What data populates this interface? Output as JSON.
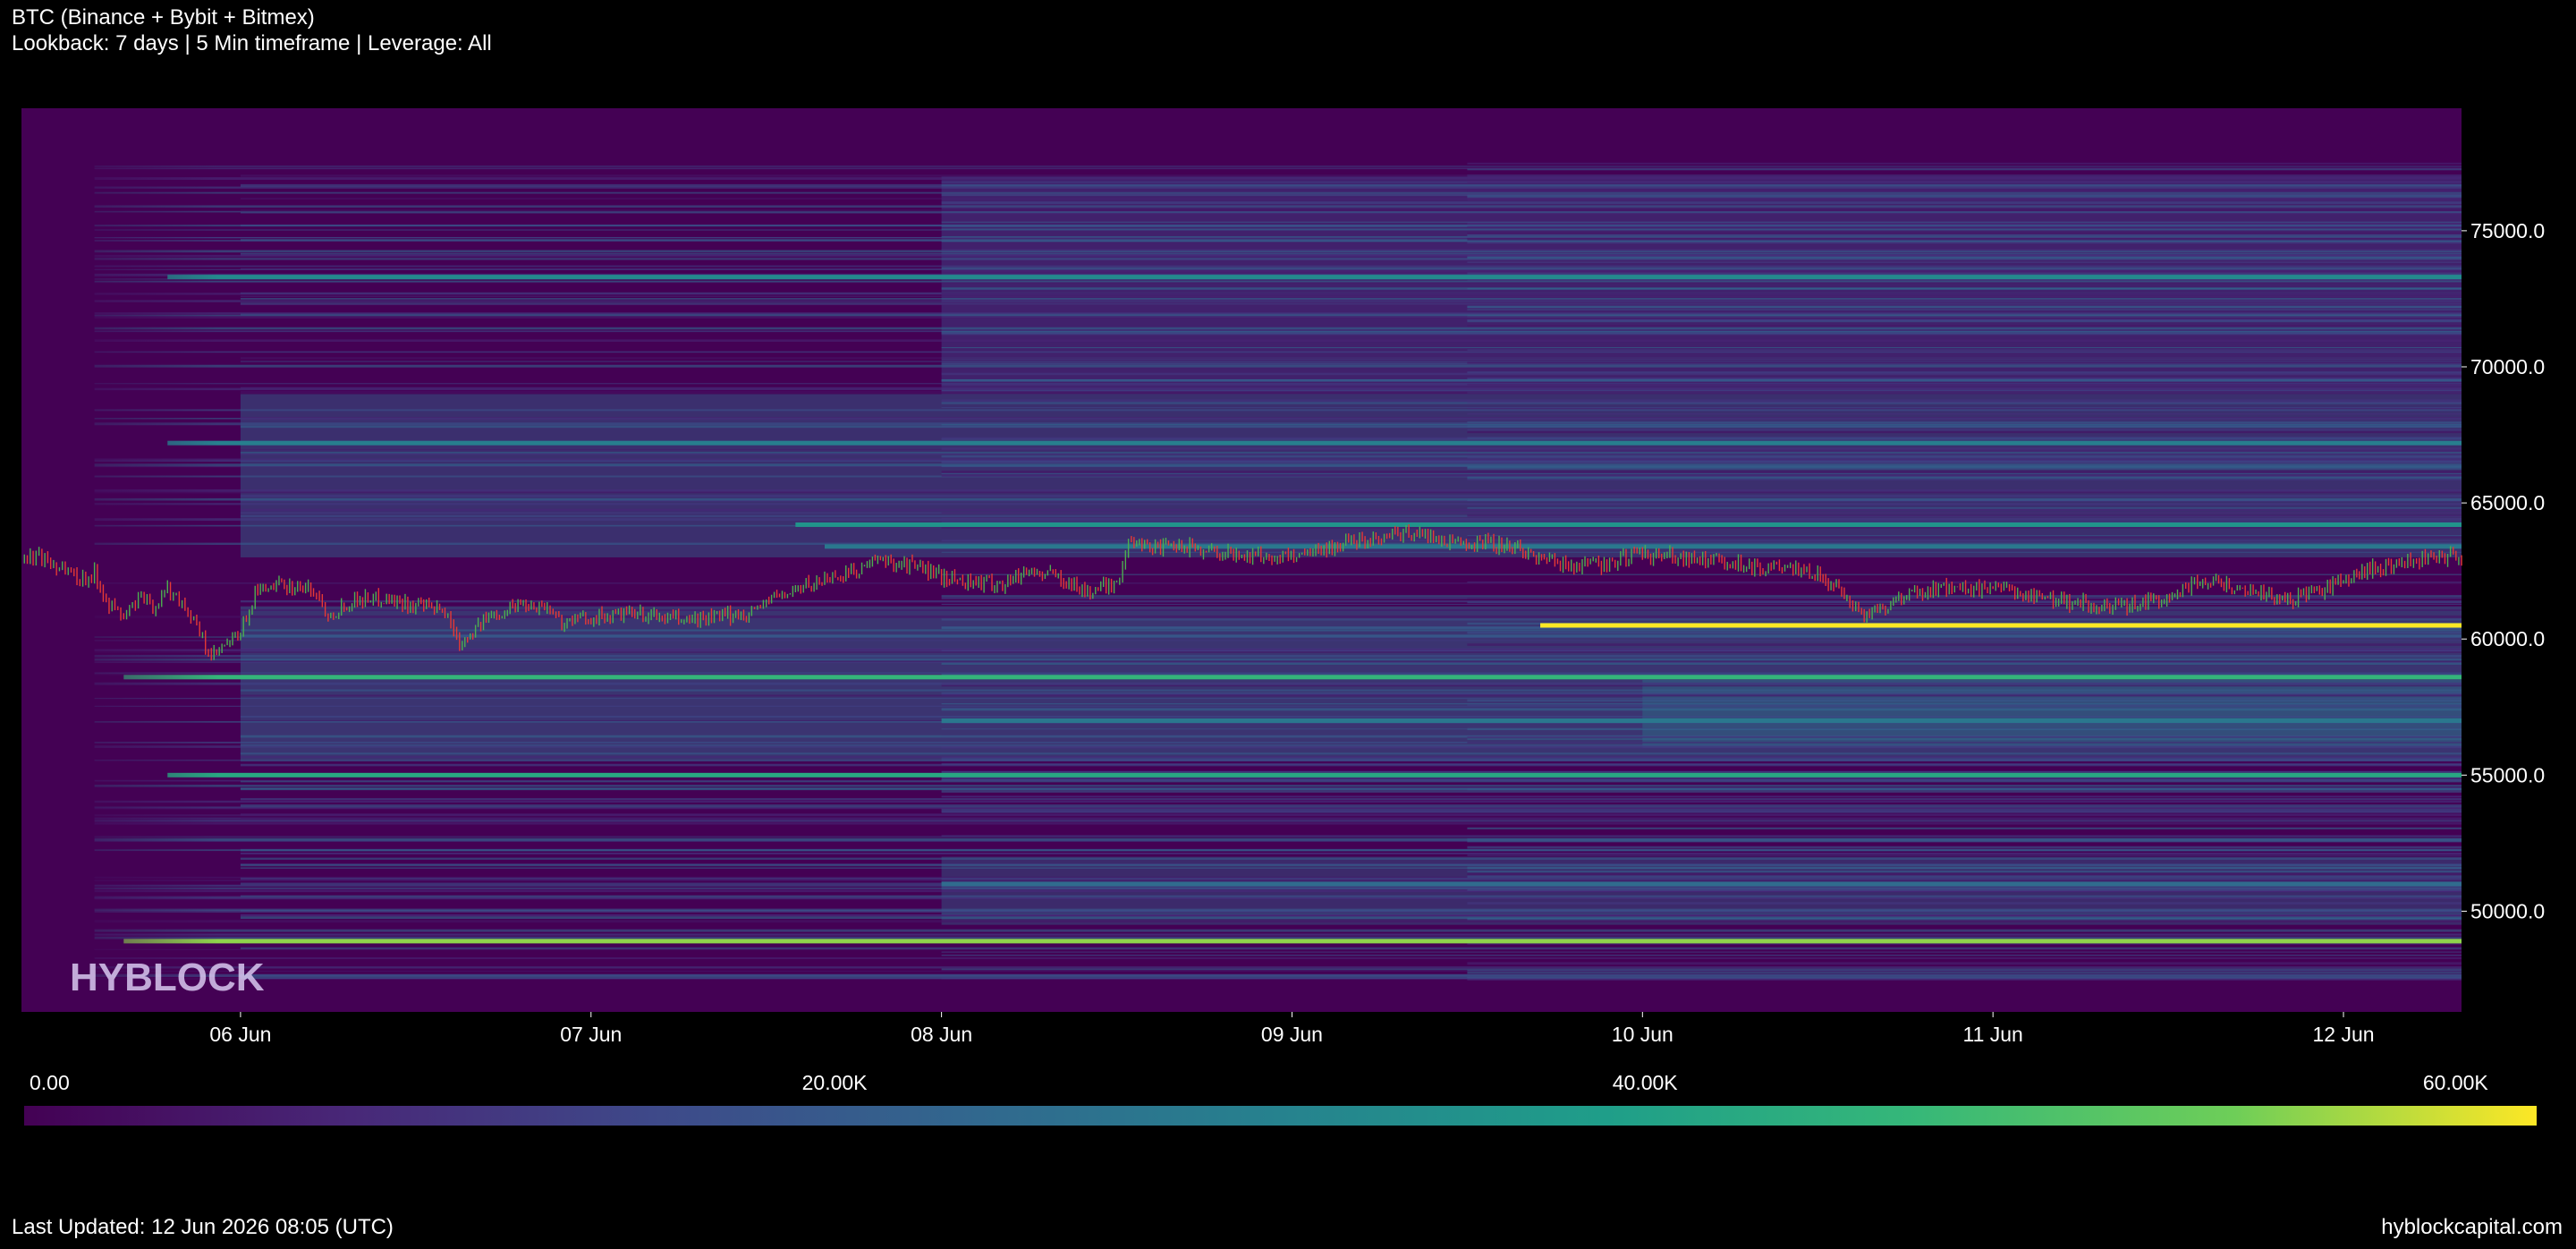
{
  "header": {
    "title": "BTC (Binance + Bybit + Bitmex)",
    "subtitle": "Lookback: 7 days | 5 Min timeframe | Leverage: All"
  },
  "watermark": "HYBLOCK",
  "footer": {
    "last_updated": "Last Updated: 12 Jun 2026 08:05 (UTC)",
    "site": "hyblockcapital.com"
  },
  "colors": {
    "background": "#000000",
    "heatmap_low": "#440154",
    "heatmap_mid": "#21908d",
    "heatmap_high": "#fde725",
    "candle_up": "#4caf50",
    "candle_down": "#e53935"
  },
  "chart_data": {
    "type": "heatmap",
    "x_axis": {
      "type": "date",
      "range": [
        "2026-06-05 09:00",
        "2026-06-12 08:05"
      ],
      "tick_labels": [
        "06 Jun",
        "07 Jun",
        "08 Jun",
        "09 Jun",
        "10 Jun",
        "11 Jun",
        "12 Jun"
      ],
      "tick_dates": [
        "2026-06-06 00:00",
        "2026-06-07 00:00",
        "2026-06-08 00:00",
        "2026-06-09 00:00",
        "2026-06-10 00:00",
        "2026-06-11 00:00",
        "2026-06-12 00:00"
      ]
    },
    "y_axis": {
      "position": "right",
      "range": [
        46300,
        79500
      ],
      "tick_values": [
        50000,
        55000,
        60000,
        65000,
        70000,
        75000
      ],
      "tick_labels": [
        "50000.0",
        "55000.0",
        "60000.0",
        "65000.0",
        "70000.0",
        "75000.0"
      ]
    },
    "colorbar": {
      "range": [
        0,
        62000
      ],
      "tick_values": [
        0,
        20000,
        40000,
        60000
      ],
      "tick_labels": [
        "0.00",
        "20.00K",
        "40.00K",
        "60.00K"
      ]
    },
    "liquidation_levels": [
      {
        "price": 73300,
        "start": "2026-06-05 19:00",
        "intensity": 33000
      },
      {
        "price": 67200,
        "start": "2026-06-05 19:00",
        "intensity": 30000
      },
      {
        "price": 64200,
        "start": "2026-06-07 14:00",
        "intensity": 36000
      },
      {
        "price": 63400,
        "start": "2026-06-07 16:00",
        "intensity": 28000
      },
      {
        "price": 60500,
        "start": "2026-06-09 17:00",
        "intensity": 62000
      },
      {
        "price": 58600,
        "start": "2026-06-05 16:00",
        "intensity": 46000
      },
      {
        "price": 57000,
        "start": "2026-06-08 00:00",
        "intensity": 28000
      },
      {
        "price": 55000,
        "start": "2026-06-05 19:00",
        "intensity": 42000
      },
      {
        "price": 51000,
        "start": "2026-06-08 00:00",
        "intensity": 24000
      },
      {
        "price": 48900,
        "start": "2026-06-05 16:00",
        "intensity": 56000
      }
    ],
    "price_path": [
      [
        "2026-06-05 09:00",
        62900
      ],
      [
        "2026-06-05 10:00",
        63100
      ],
      [
        "2026-06-05 11:00",
        62800
      ],
      [
        "2026-06-05 12:00",
        62600
      ],
      [
        "2026-06-05 13:00",
        62200
      ],
      [
        "2026-06-05 14:00",
        62400
      ],
      [
        "2026-06-05 15:00",
        61300
      ],
      [
        "2026-06-05 16:00",
        60800
      ],
      [
        "2026-06-05 17:00",
        61500
      ],
      [
        "2026-06-05 18:00",
        61200
      ],
      [
        "2026-06-05 19:00",
        61800
      ],
      [
        "2026-06-05 20:00",
        61400
      ],
      [
        "2026-06-05 21:00",
        60400
      ],
      [
        "2026-06-05 22:00",
        59300
      ],
      [
        "2026-06-06 00:00",
        60200
      ],
      [
        "2026-06-06 01:00",
        61700
      ],
      [
        "2026-06-06 03:00",
        62000
      ],
      [
        "2026-06-06 05:00",
        61800
      ],
      [
        "2026-06-06 06:00",
        60900
      ],
      [
        "2026-06-06 08:00",
        61500
      ],
      [
        "2026-06-06 10:00",
        61500
      ],
      [
        "2026-06-06 12:00",
        61200
      ],
      [
        "2026-06-06 14:00",
        61000
      ],
      [
        "2026-06-06 15:00",
        59900
      ],
      [
        "2026-06-06 17:00",
        60800
      ],
      [
        "2026-06-06 19:00",
        61300
      ],
      [
        "2026-06-06 21:00",
        61200
      ],
      [
        "2026-06-06 22:00",
        60600
      ],
      [
        "2026-06-07 00:00",
        60800
      ],
      [
        "2026-06-07 03:00",
        60900
      ],
      [
        "2026-06-07 06:00",
        60700
      ],
      [
        "2026-06-07 09:00",
        60800
      ],
      [
        "2026-06-07 11:00",
        61000
      ],
      [
        "2026-06-07 12:00",
        61400
      ],
      [
        "2026-06-07 14:00",
        61800
      ],
      [
        "2026-06-07 16:00",
        62200
      ],
      [
        "2026-06-07 18:00",
        62500
      ],
      [
        "2026-06-07 20:00",
        62900
      ],
      [
        "2026-06-07 22:00",
        62700
      ],
      [
        "2026-06-08 00:00",
        62300
      ],
      [
        "2026-06-08 02:00",
        62100
      ],
      [
        "2026-06-08 04:00",
        62000
      ],
      [
        "2026-06-08 06:00",
        62500
      ],
      [
        "2026-06-08 08:00",
        62300
      ],
      [
        "2026-06-08 10:00",
        61700
      ],
      [
        "2026-06-08 12:00",
        62100
      ],
      [
        "2026-06-08 13:00",
        63700
      ],
      [
        "2026-06-08 15:00",
        63300
      ],
      [
        "2026-06-08 17:00",
        63400
      ],
      [
        "2026-06-08 20:00",
        63100
      ],
      [
        "2026-06-08 23:00",
        63000
      ],
      [
        "2026-06-09 02:00",
        63300
      ],
      [
        "2026-06-09 05:00",
        63700
      ],
      [
        "2026-06-09 08:00",
        63900
      ],
      [
        "2026-06-09 11:00",
        63600
      ],
      [
        "2026-06-09 14:00",
        63500
      ],
      [
        "2026-06-09 16:00",
        63200
      ],
      [
        "2026-06-09 18:00",
        62800
      ],
      [
        "2026-06-09 21:00",
        62700
      ],
      [
        "2026-06-10 00:00",
        63100
      ],
      [
        "2026-06-10 03:00",
        63000
      ],
      [
        "2026-06-10 06:00",
        62800
      ],
      [
        "2026-06-10 09:00",
        62600
      ],
      [
        "2026-06-10 12:00",
        62400
      ],
      [
        "2026-06-10 14:00",
        61500
      ],
      [
        "2026-06-10 15:00",
        60900
      ],
      [
        "2026-06-10 17:00",
        61300
      ],
      [
        "2026-06-10 19:00",
        61700
      ],
      [
        "2026-06-10 21:00",
        61900
      ],
      [
        "2026-06-11 00:00",
        61800
      ],
      [
        "2026-06-11 03:00",
        61600
      ],
      [
        "2026-06-11 06:00",
        61300
      ],
      [
        "2026-06-11 08:00",
        61100
      ],
      [
        "2026-06-11 09:00",
        61200
      ],
      [
        "2026-06-11 11:00",
        61400
      ],
      [
        "2026-06-11 13:00",
        61800
      ],
      [
        "2026-06-11 14:00",
        62200
      ],
      [
        "2026-06-11 16:00",
        62000
      ],
      [
        "2026-06-11 18:00",
        61700
      ],
      [
        "2026-06-11 20:00",
        61400
      ],
      [
        "2026-06-11 22:00",
        61700
      ],
      [
        "2026-06-12 00:00",
        62100
      ],
      [
        "2026-06-12 02:00",
        62600
      ],
      [
        "2026-06-12 04:00",
        62700
      ],
      [
        "2026-06-12 05:00",
        62900
      ],
      [
        "2026-06-12 06:00",
        63100
      ],
      [
        "2026-06-12 08:05",
        63000
      ]
    ]
  }
}
